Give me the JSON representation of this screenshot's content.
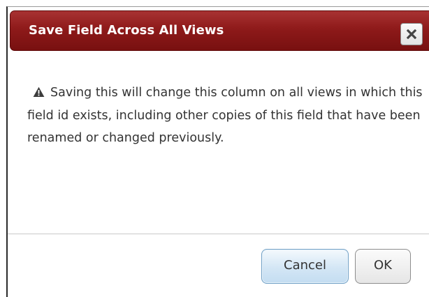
{
  "dialog": {
    "title": "Save Field Across All Views",
    "close_icon": "close-icon",
    "warning_icon": "warning-triangle-icon",
    "message": "Saving this will change this column on all views in which this field id exists, including other copies of this field that have been renamed or changed previously.",
    "buttons": {
      "cancel_label": "Cancel",
      "ok_label": "OK"
    }
  },
  "colors": {
    "titlebar": "#8e1a1a",
    "title_text": "#ffffff",
    "cancel_button": "#d3e6f5",
    "ok_button": "#e6e6e6"
  }
}
